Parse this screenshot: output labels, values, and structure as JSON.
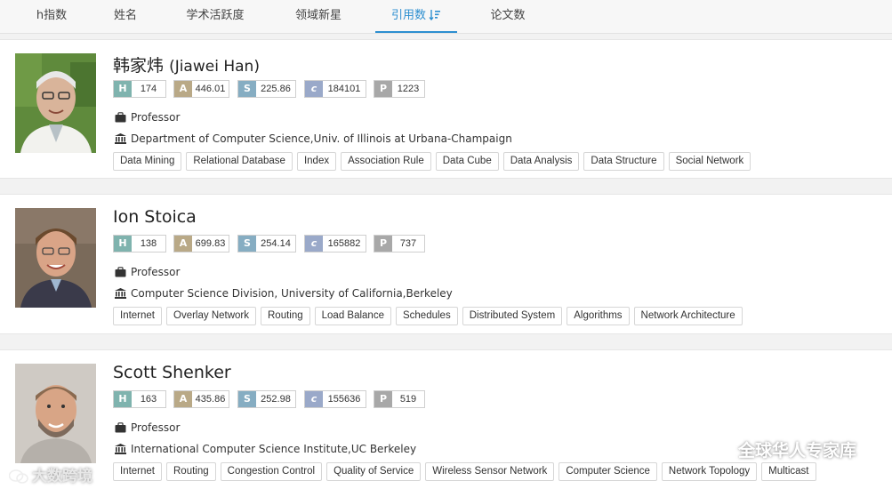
{
  "tabs": [
    {
      "label": "h指数",
      "active": false
    },
    {
      "label": "姓名",
      "active": false
    },
    {
      "label": "学术活跃度",
      "active": false
    },
    {
      "label": "领域新星",
      "active": false
    },
    {
      "label": "引用数",
      "active": true,
      "icon": "sort-descending-icon"
    },
    {
      "label": "论文数",
      "active": false
    }
  ],
  "metric_labels": {
    "h": "H",
    "a": "A",
    "s": "S",
    "c": "c",
    "p": "P"
  },
  "scholars": [
    {
      "name": "韩家炜",
      "name_en": "(Jiawei Han)",
      "metrics": {
        "h": "174",
        "a": "446.01",
        "s": "225.86",
        "c": "184101",
        "p": "1223"
      },
      "position": "Professor",
      "affiliation": "Department of Computer Science,Univ. of Illinois at Urbana-Champaign",
      "tags": [
        "Data Mining",
        "Relational Database",
        "Index",
        "Association Rule",
        "Data Cube",
        "Data Analysis",
        "Data Structure",
        "Social Network"
      ]
    },
    {
      "name": "Ion Stoica",
      "name_en": "",
      "metrics": {
        "h": "138",
        "a": "699.83",
        "s": "254.14",
        "c": "165882",
        "p": "737"
      },
      "position": "Professor",
      "affiliation": "Computer Science Division, University of California,Berkeley",
      "tags": [
        "Internet",
        "Overlay Network",
        "Routing",
        "Load Balance",
        "Schedules",
        "Distributed System",
        "Algorithms",
        "Network Architecture"
      ]
    },
    {
      "name": "Scott Shenker",
      "name_en": "",
      "metrics": {
        "h": "163",
        "a": "435.86",
        "s": "252.98",
        "c": "155636",
        "p": "519"
      },
      "position": "Professor",
      "affiliation": "International Computer Science Institute,UC Berkeley",
      "tags": [
        "Internet",
        "Routing",
        "Congestion Control",
        "Quality of Service",
        "Wireless Sensor Network",
        "Computer Science",
        "Network Topology",
        "Multicast"
      ]
    }
  ],
  "watermarks": {
    "left": "大数跨境",
    "right": "全球华人专家库"
  },
  "colors": {
    "accent": "#2c8fd0",
    "h": "#7fb3ae",
    "a": "#b9a987",
    "s": "#86adc2",
    "c": "#9aa9c9",
    "p": "#a8a8a8"
  }
}
